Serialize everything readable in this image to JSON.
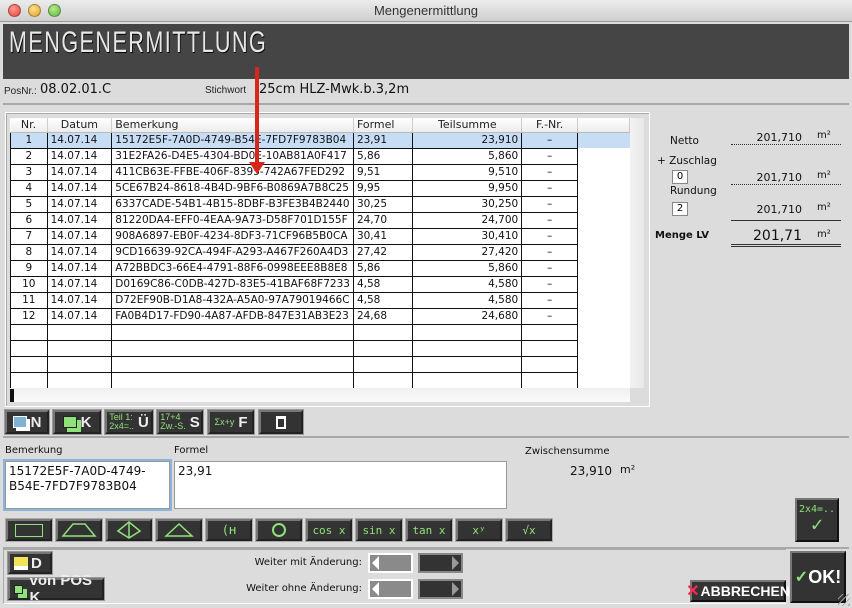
{
  "window": {
    "title": "Mengenermittlung"
  },
  "banner": {
    "title": "MENGENERMITTLUNG"
  },
  "position": {
    "posnr_label": "PosNr.:",
    "posnr_value": "08.02.01.C",
    "stichwort_label": "Stichwort",
    "stichwort_value": "25cm HLZ-Mwk.b.3,2m"
  },
  "table": {
    "columns": [
      "Nr.",
      "Datum",
      "Bemerkung",
      "Formel",
      "Teilsumme",
      "F.-Nr."
    ],
    "rows": [
      {
        "nr": "1",
        "datum": "14.07.14",
        "bemerkung": "15172E5F-7A0D-4749-B54E-7FD7F9783B04",
        "formel": "23,91",
        "teilsumme": "23,910",
        "fnr": "–"
      },
      {
        "nr": "2",
        "datum": "14.07.14",
        "bemerkung": "31E2FA26-D4E5-4304-BD0E-10AB81A0F417",
        "formel": "5,86",
        "teilsumme": "5,860",
        "fnr": "–"
      },
      {
        "nr": "3",
        "datum": "14.07.14",
        "bemerkung": "411CB63E-FFBE-406F-8395-742A67FED292",
        "formel": "9,51",
        "teilsumme": "9,510",
        "fnr": "–"
      },
      {
        "nr": "4",
        "datum": "14.07.14",
        "bemerkung": "5CE67B24-8618-4B4D-9BF6-B0869A7B8C25",
        "formel": "9,95",
        "teilsumme": "9,950",
        "fnr": "–"
      },
      {
        "nr": "5",
        "datum": "14.07.14",
        "bemerkung": "6337CADE-54B1-4B15-8DBF-B3FE3B4B2440",
        "formel": "30,25",
        "teilsumme": "30,250",
        "fnr": "–"
      },
      {
        "nr": "6",
        "datum": "14.07.14",
        "bemerkung": "81220DA4-EFF0-4EAA-9A73-D58F701D155F",
        "formel": "24,70",
        "teilsumme": "24,700",
        "fnr": "–"
      },
      {
        "nr": "7",
        "datum": "14.07.14",
        "bemerkung": "908A6897-EB0F-4234-8DF3-71CF96B5B0CA",
        "formel": "30,41",
        "teilsumme": "30,410",
        "fnr": "–"
      },
      {
        "nr": "8",
        "datum": "14.07.14",
        "bemerkung": "9CD16639-92CA-494F-A293-A467F260A4D3",
        "formel": "27,42",
        "teilsumme": "27,420",
        "fnr": "–"
      },
      {
        "nr": "9",
        "datum": "14.07.14",
        "bemerkung": "A72BBDC3-66E4-4791-88F6-0998EEE8B8E8",
        "formel": "5,86",
        "teilsumme": "5,860",
        "fnr": "–"
      },
      {
        "nr": "10",
        "datum": "14.07.14",
        "bemerkung": "D0169C86-C0DB-427D-83E5-41BAF68F7233",
        "formel": "4,58",
        "teilsumme": "4,580",
        "fnr": "–"
      },
      {
        "nr": "11",
        "datum": "14.07.14",
        "bemerkung": "D72EF90B-D1A8-432A-A5A0-97A79019466C",
        "formel": "4,58",
        "teilsumme": "4,580",
        "fnr": "–"
      },
      {
        "nr": "12",
        "datum": "14.07.14",
        "bemerkung": "FA0B4D17-FD90-4A87-AFDB-847E31AB3E23",
        "formel": "24,68",
        "teilsumme": "24,680",
        "fnr": "–"
      }
    ],
    "empty_rows": 4,
    "selected_row": 0
  },
  "summary": {
    "netto_label": "Netto",
    "netto_value": "201,710",
    "unit": "m²",
    "zuschlag_label": "+ Zuschlag",
    "zuschlag_input": "0",
    "zuschlag_value": "201,710",
    "rundung_label": "Rundung",
    "rundung_input": "2",
    "rundung_value": "201,710",
    "menge_label": "Menge LV",
    "menge_value": "201,71"
  },
  "toolbar": {
    "new_label": "N",
    "copy_label": "K",
    "transfer_label": "Ü",
    "transfer_sub": "Teil 1: 2x4=..",
    "sum_label": "S",
    "sum_sub": "17+4 Zw.-S.",
    "formula_label": "F",
    "formula_sub": "Σx+y"
  },
  "editor": {
    "bemerkung_label": "Bemerkung",
    "bemerkung_value": "15172E5F-7A0D-4749-\nB54E-7FD7F9783B04",
    "formel_label": "Formel",
    "formel_value": "23,91",
    "zwischensumme_label": "Zwischensumme",
    "zwischensumme_value": "23,910",
    "unit": "m²"
  },
  "functions": [
    "cos x",
    "sin x",
    "tan x",
    "xʸ",
    "√x"
  ],
  "calc_button": {
    "label": "2x4=..",
    "icon": "check-icon"
  },
  "bottom": {
    "print_label": "D",
    "vonpos_label": "von POS K",
    "weiter_mit_label": "Weiter mit Änderung:",
    "weiter_ohne_label": "Weiter ohne Änderung:",
    "cancel_label": "ABBRECHEN",
    "ok_label": "OK!"
  }
}
